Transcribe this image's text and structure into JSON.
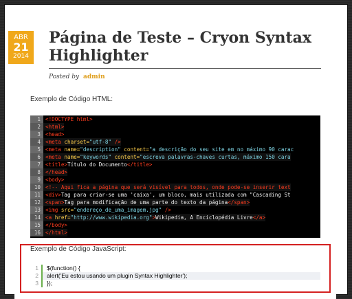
{
  "post": {
    "date": {
      "month": "ABR",
      "day": "21",
      "year": "2014"
    },
    "title": "Página de Teste – Cryon Syntax Highlighter",
    "posted_by_label": "Posted by",
    "author": "admin"
  },
  "sections": {
    "html_label": "Exemplo de Código HTML:",
    "js_label": "Exemplo de Código JavaScript:"
  },
  "html_code": [
    [
      {
        "t": "tag",
        "v": "<!DOCTYPE html>"
      }
    ],
    [
      {
        "t": "tag",
        "v": "<html>"
      }
    ],
    [
      {
        "t": "tag",
        "v": "<head>"
      }
    ],
    [
      {
        "t": "tag",
        "v": "<meta "
      },
      {
        "t": "attr",
        "v": "charset="
      },
      {
        "t": "str",
        "v": "\"utf-8\""
      },
      {
        "t": "tag",
        "v": " />"
      }
    ],
    [
      {
        "t": "tag",
        "v": "<meta "
      },
      {
        "t": "attr",
        "v": "name="
      },
      {
        "t": "str",
        "v": "\"description\""
      },
      {
        "t": "attr",
        "v": " content="
      },
      {
        "t": "str",
        "v": "\"a descrição do seu site em no máximo 90 carac"
      }
    ],
    [
      {
        "t": "tag",
        "v": "<meta "
      },
      {
        "t": "attr",
        "v": "name="
      },
      {
        "t": "str",
        "v": "\"keywords\""
      },
      {
        "t": "attr",
        "v": " content="
      },
      {
        "t": "str",
        "v": "\"escreva palavras-chaves curtas, máximo 150 cara"
      }
    ],
    [
      {
        "t": "tag",
        "v": "<title>"
      },
      {
        "t": "plain",
        "v": "Título do Documento"
      },
      {
        "t": "tag",
        "v": "</title>"
      }
    ],
    [
      {
        "t": "tag",
        "v": "</head>"
      }
    ],
    [
      {
        "t": "tag",
        "v": "<body>"
      }
    ],
    [
      {
        "t": "tag",
        "v": "<!-- Aqui fica a página que será visível para todos, onde pode-se inserir text"
      }
    ],
    [
      {
        "t": "tag",
        "v": "<div>"
      },
      {
        "t": "plain",
        "v": "Tag para criar-se uma 'caixa', um bloco, mais utilizada com \"Cascading St"
      }
    ],
    [
      {
        "t": "tag",
        "v": "<span>"
      },
      {
        "t": "plain",
        "v": "Tag para modificação de uma parte do texto da página"
      },
      {
        "t": "tag",
        "v": "</span>"
      }
    ],
    [
      {
        "t": "tag",
        "v": "<img "
      },
      {
        "t": "attr",
        "v": "src="
      },
      {
        "t": "str",
        "v": "\"endereço_de_uma_imagem.jpg\""
      },
      {
        "t": "tag",
        "v": " />"
      }
    ],
    [
      {
        "t": "tag",
        "v": "<a "
      },
      {
        "t": "attr",
        "v": "href="
      },
      {
        "t": "str",
        "v": "\"http://www.wikipedia.org\""
      },
      {
        "t": "tag",
        "v": ">"
      },
      {
        "t": "plain",
        "v": "Wikipedia, A Enciclopédia Livre"
      },
      {
        "t": "tag",
        "v": "</a>"
      }
    ],
    [
      {
        "t": "tag",
        "v": "</body>"
      }
    ],
    [
      {
        "t": "tag",
        "v": "</html>"
      }
    ]
  ],
  "js_code": [
    "$(function() {",
    "alert('Eu estou usando um plugin Syntax Highlighter');",
    "});"
  ],
  "colors": {
    "accent": "#f0a81b",
    "highlight_border": "#d42020",
    "tag": "#ff3c1e",
    "attr": "#ffcf4a",
    "string": "#7fd6e6"
  }
}
